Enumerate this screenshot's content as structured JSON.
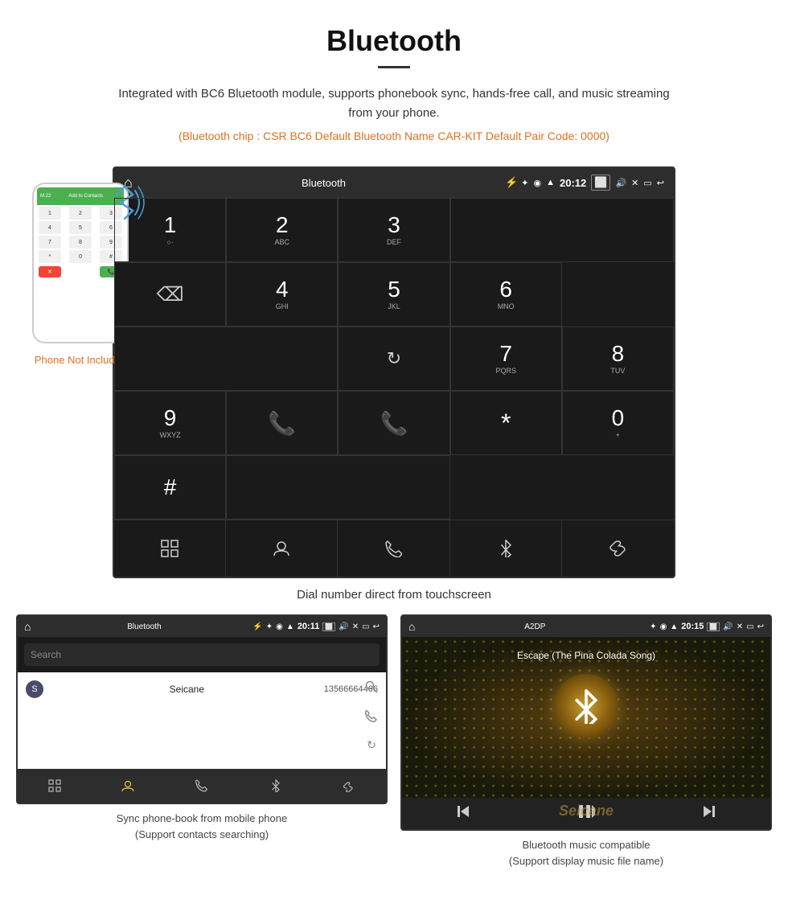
{
  "page": {
    "title": "Bluetooth",
    "description": "Integrated with BC6 Bluetooth module, supports phonebook sync, hands-free call, and music streaming from your phone.",
    "specs": "(Bluetooth chip : CSR BC6    Default Bluetooth Name CAR-KIT    Default Pair Code: 0000)",
    "phone_not_included": "Phone Not Included",
    "dial_caption": "Dial number direct from touchscreen",
    "phonebook_caption": "Sync phone-book from mobile phone\n(Support contacts searching)",
    "music_caption": "Bluetooth music compatible\n(Support display music file name)"
  },
  "dial_screen": {
    "statusbar_title": "Bluetooth",
    "time": "20:12",
    "keys": [
      {
        "num": "1",
        "letters": "○·"
      },
      {
        "num": "2",
        "letters": "ABC"
      },
      {
        "num": "3",
        "letters": "DEF"
      },
      {
        "num": "",
        "letters": ""
      },
      {
        "num": "⌫",
        "letters": ""
      }
    ],
    "keys_row2": [
      {
        "num": "4",
        "letters": "GHI"
      },
      {
        "num": "5",
        "letters": "JKL"
      },
      {
        "num": "6",
        "letters": "MNO"
      }
    ],
    "keys_row3": [
      {
        "num": "7",
        "letters": "PQRS"
      },
      {
        "num": "8",
        "letters": "TUV"
      },
      {
        "num": "9",
        "letters": "WXYZ"
      }
    ],
    "keys_row4": [
      {
        "num": "*",
        "letters": ""
      },
      {
        "num": "0",
        "letters": "+"
      },
      {
        "num": "#",
        "letters": ""
      }
    ],
    "toolbar_items": [
      "grid",
      "person",
      "phone",
      "bluetooth",
      "link"
    ]
  },
  "phonebook_screen": {
    "statusbar_title": "Bluetooth",
    "time": "20:11",
    "search_placeholder": "Search",
    "contact": {
      "letter": "S",
      "name": "Seicane",
      "number": "13566664466"
    },
    "toolbar_items": [
      "grid",
      "person",
      "phone",
      "bluetooth",
      "link"
    ]
  },
  "music_screen": {
    "statusbar_title": "A2DP",
    "time": "20:15",
    "song_title": "Escape (The Pina Colada Song)",
    "controls": [
      "prev",
      "play-pause",
      "next"
    ]
  },
  "icons": {
    "home": "⌂",
    "usb": "⚡",
    "bluetooth": "✦",
    "location": "◉",
    "signal": "▲",
    "camera": "📷",
    "volume": "🔊",
    "close": "✕",
    "screen": "▭",
    "back": "↩",
    "backspace": "⌫",
    "refresh": "↻",
    "call_green": "📞",
    "call_red": "📞",
    "grid": "⊞",
    "person": "👤",
    "phone": "☎",
    "link": "🔗",
    "search": "🔍",
    "skip_prev": "⏮",
    "play_pause": "⏯",
    "skip_next": "⏭"
  }
}
